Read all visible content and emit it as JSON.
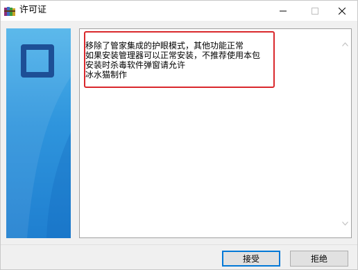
{
  "window": {
    "title": "许可证",
    "icon": "winrar-books-icon",
    "controls": [
      "minimize-icon",
      "maximize-icon",
      "close-icon"
    ]
  },
  "license": {
    "lines": [
      "移除了管家集成的护眼模式，其他功能正常",
      "如果安装管理器可以正常安装，不推荐使用本包",
      "安装时杀毒软件弹窗请允许",
      "冰水猫制作"
    ]
  },
  "buttons": {
    "accept_label": "接受",
    "decline_label": "拒绝"
  },
  "colors": {
    "highlight_border": "#d9272b",
    "banner_top": "#4fb3ea",
    "banner_bottom": "#1f7fd0",
    "logo": "#1d4f96",
    "default_button_border": "#0078d7"
  }
}
